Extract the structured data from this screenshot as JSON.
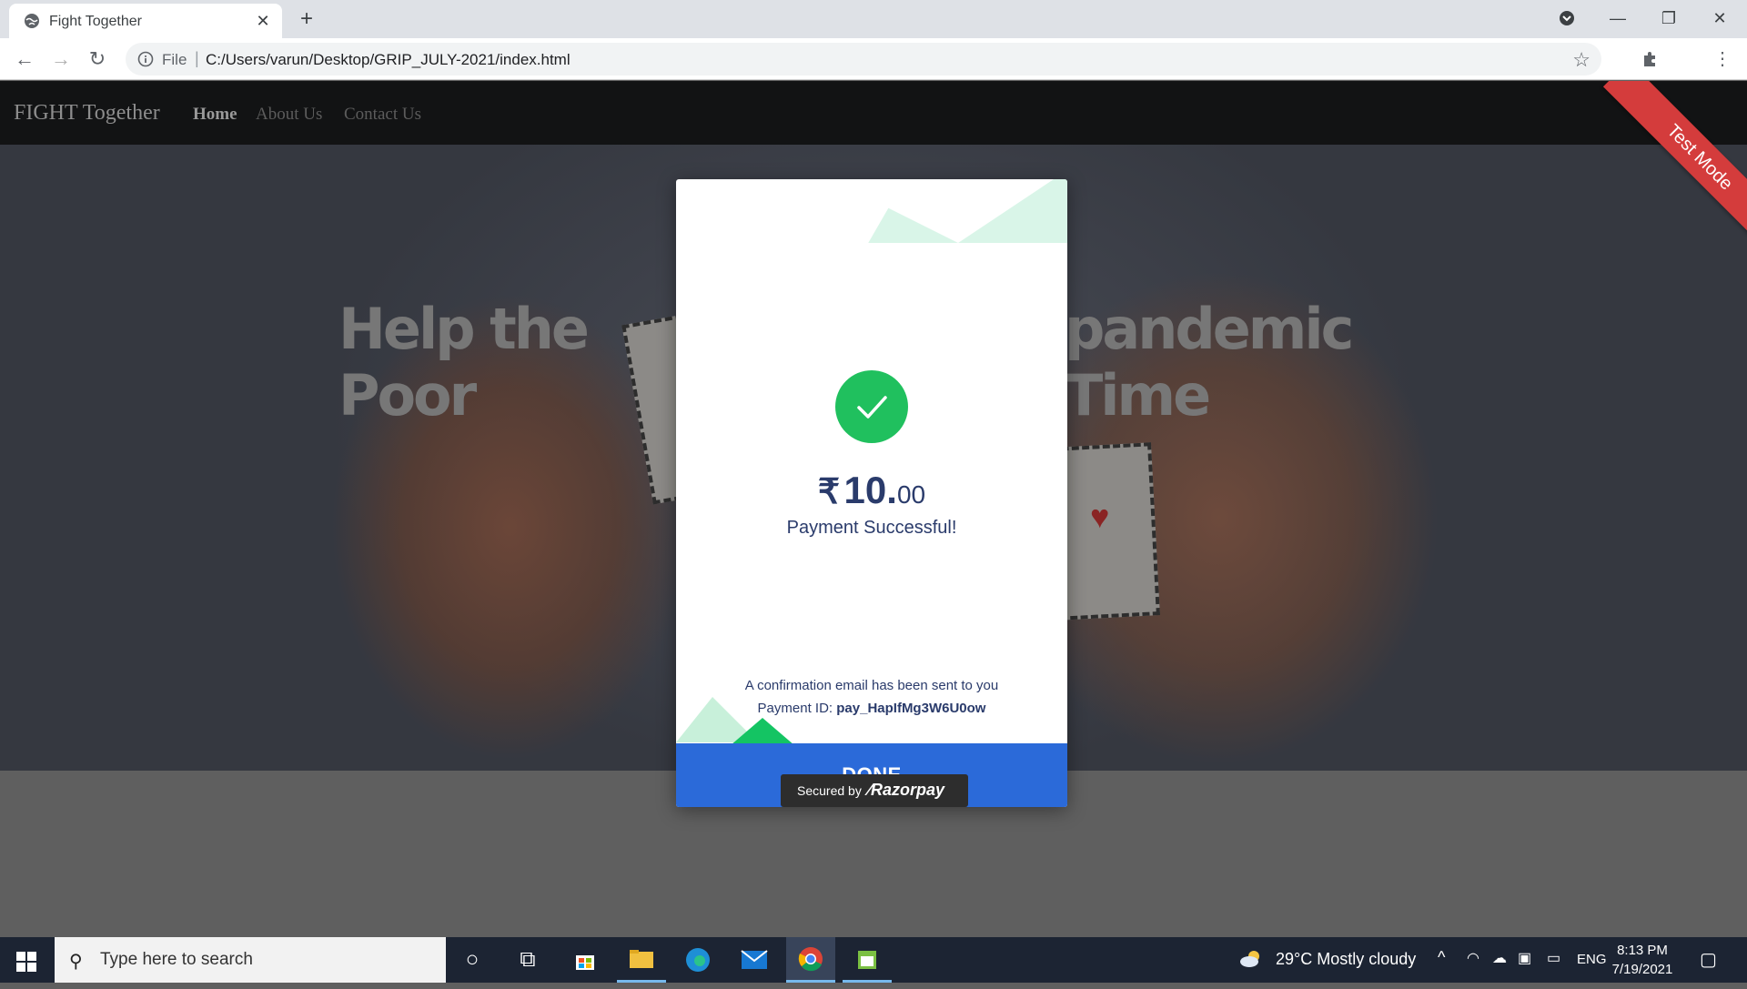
{
  "browser": {
    "tab_title": "Fight Together",
    "address_file_label": "File",
    "address_separator": "|",
    "url": "C:/Users/varun/Desktop/GRIP_JULY-2021/index.html"
  },
  "site": {
    "brand": "FIGHT Together",
    "nav": [
      {
        "label": "Home",
        "active": true
      },
      {
        "label": "About Us",
        "active": false
      },
      {
        "label": "Contact Us",
        "active": false
      }
    ],
    "hero_left": "Help the Poor",
    "hero_right": "pandemic Time",
    "ribbon": "Test Mode"
  },
  "payment": {
    "currency_symbol": "₹",
    "amount_whole": "10.",
    "amount_decimal": "00",
    "status": "Payment Successful!",
    "confirmation": "A confirmation email has been sent to you",
    "payment_id_label": "Payment ID:",
    "payment_id": "pay_HapIfMg3W6U0ow",
    "done_label": "DONE",
    "secured_label": "Secured by",
    "secured_brand": "Razorpay",
    "success_color": "#20c05e",
    "button_color": "#2b6ad9"
  },
  "taskbar": {
    "search_placeholder": "Type here to search",
    "weather": "29°C  Mostly cloudy",
    "language": "ENG",
    "time": "8:13 PM",
    "date": "7/19/2021"
  }
}
